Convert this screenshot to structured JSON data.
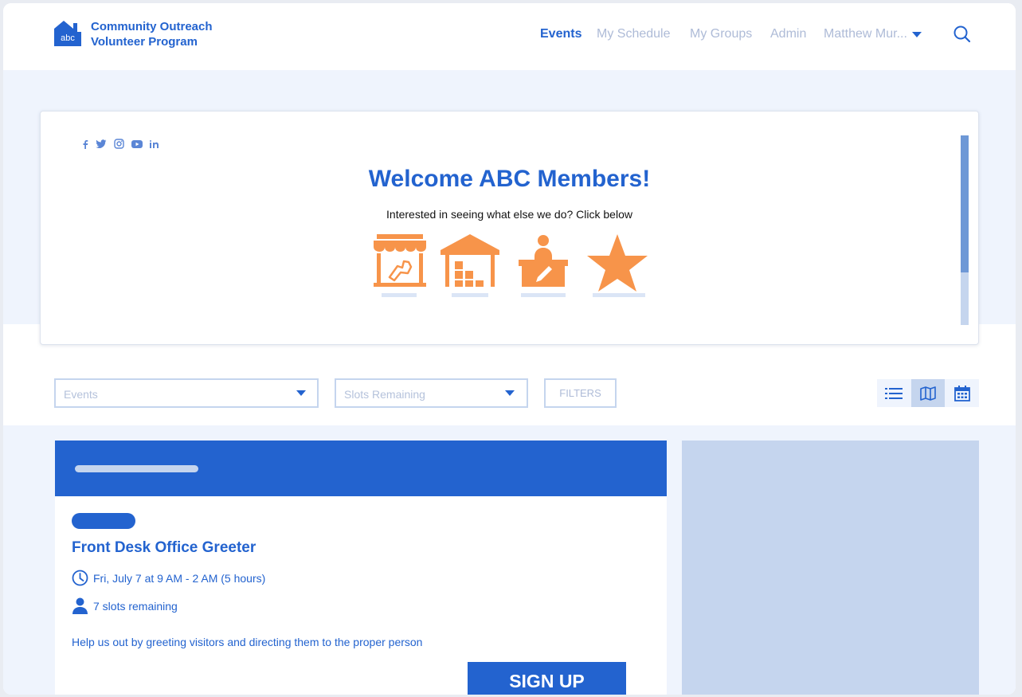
{
  "header": {
    "brand_line1": "Community Outreach",
    "brand_line2": "Volunteer Program",
    "logo_text": "abc",
    "nav": [
      {
        "label": "Events",
        "active": true
      },
      {
        "label": "My Schedule",
        "active": false
      },
      {
        "label": "My Groups",
        "active": false
      },
      {
        "label": "Admin",
        "active": false
      }
    ],
    "user_menu_label": "Matthew Mur...",
    "icons": [
      "house-logo-icon",
      "chevron-down-icon",
      "search-icon"
    ]
  },
  "welcome": {
    "social_icons": [
      "facebook-icon",
      "twitter-icon",
      "instagram-icon",
      "youtube-icon",
      "linkedin-icon"
    ],
    "title": "Welcome ABC Members!",
    "subtitle": "Interested in seeing what else we do? Click below",
    "tiles": [
      "market-stall-icon",
      "warehouse-boxes-icon",
      "desk-clerk-icon",
      "star-icon"
    ],
    "accent_color": "#f7944a"
  },
  "controls": {
    "events_select_placeholder": "Events",
    "slots_select_placeholder": "Slots Remaining",
    "filters_label": "FILTERS",
    "view_modes": [
      "list-view-icon",
      "map-view-icon",
      "calendar-view-icon"
    ],
    "selected_view": "map-view-icon"
  },
  "event": {
    "title": "Front Desk Office Greeter",
    "datetime": "Fri, July 7 at 9 AM - 2 AM (5 hours)",
    "slots": "7 slots remaining",
    "description": "Help us out by greeting visitors and directing them to the proper person",
    "signup_label": "SIGN UP"
  },
  "colors": {
    "primary": "#2363cf",
    "muted": "#aebbd7",
    "light_bg": "#eff4fd",
    "panel": "#c5d5ee"
  }
}
